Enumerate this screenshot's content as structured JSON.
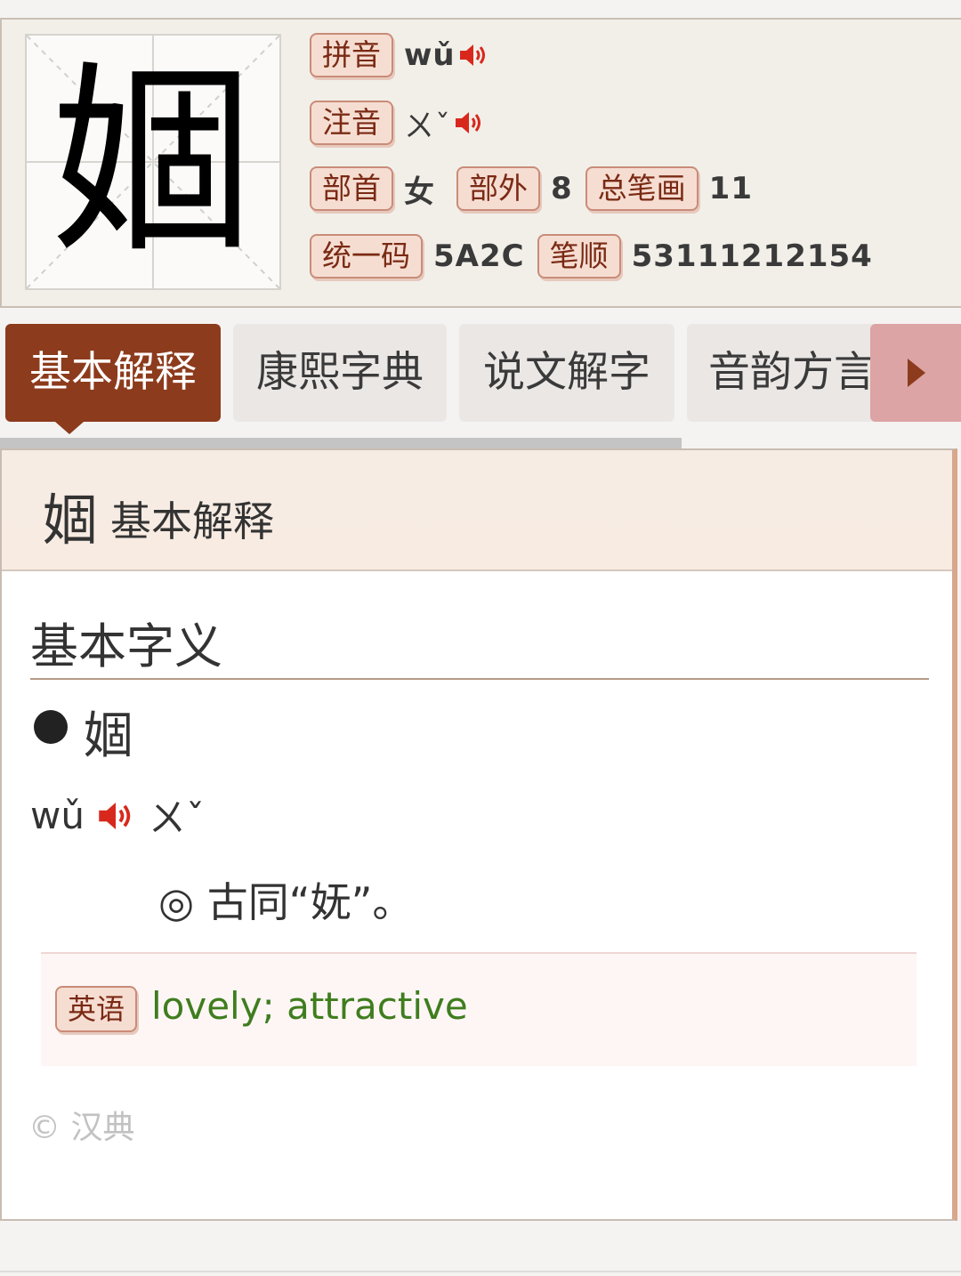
{
  "character": "婟",
  "header": {
    "pinyin_label": "拼音",
    "pinyin_value": "wǔ",
    "zhuyin_label": "注音",
    "zhuyin_value": "ㄨˇ",
    "radical_label": "部首",
    "radical_value": "女",
    "strokes_outside_label": "部外",
    "strokes_outside_value": "8",
    "total_strokes_label": "总笔画",
    "total_strokes_value": "11",
    "unicode_label": "统一码",
    "unicode_value": "5A2C",
    "stroke_order_label": "笔顺",
    "stroke_order_value": "53111212154"
  },
  "tabs": [
    {
      "label": "基本解释",
      "active": true
    },
    {
      "label": "康熙字典",
      "active": false
    },
    {
      "label": "说文解字",
      "active": false
    },
    {
      "label": "音韵方言",
      "active": false
    }
  ],
  "panel": {
    "heading_char": "婟",
    "heading_text": "基本解释",
    "section_title": "基本字义",
    "entry_char": "婟",
    "pinyin": "wǔ",
    "zhuyin": "ㄨˇ",
    "definition": "◎ 古同“妩”。",
    "english_label": "英语",
    "english_text": "lovely; attractive",
    "copyright": "© 汉典"
  },
  "icons": {
    "speaker": "speaker-icon",
    "next_tab": "triangle-right-icon",
    "bullet": "bullet-icon"
  },
  "colors": {
    "accent": "#8c3b1c",
    "tag_bg": "#f6ddd2",
    "speaker_red": "#d8281d",
    "english_green": "#3f7d1e"
  }
}
